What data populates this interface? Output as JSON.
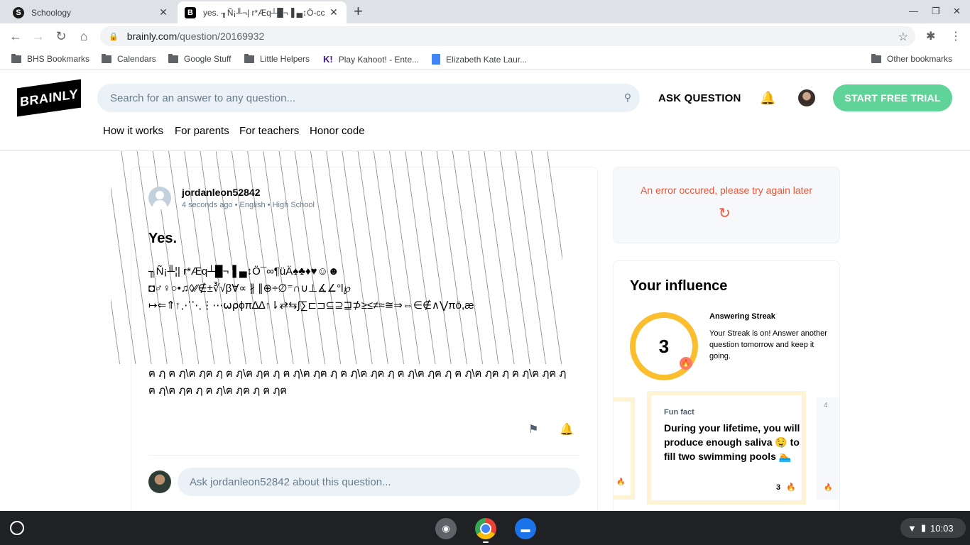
{
  "browser": {
    "tabs": [
      {
        "favicon": "S",
        "title": "Schoology"
      },
      {
        "favicon": "B",
        "title": "yes. ╖Ñ¡╨¬| r*Æq┴█¬▐ ▄↕Ö-cc"
      }
    ],
    "url_host": "brainly.com",
    "url_path": "/question/20169932",
    "bookmarks": [
      {
        "label": "BHS Bookmarks",
        "icon": "folder-icon"
      },
      {
        "label": "Calendars",
        "icon": "folder-icon"
      },
      {
        "label": "Google Stuff",
        "icon": "folder-icon"
      },
      {
        "label": "Little Helpers",
        "icon": "folder-icon"
      },
      {
        "label": "Play Kahoot! - Ente...",
        "icon": "kahoot-icon"
      },
      {
        "label": "Elizabeth Kate Laur...",
        "icon": "doc-icon"
      }
    ],
    "other_bookmarks": "Other bookmarks"
  },
  "brainly": {
    "logo": "BRAINLY",
    "search_placeholder": "Search for an answer to any question...",
    "ask_question": "ASK QUESTION",
    "trial_button": "START FREE TRIAL",
    "subnav": [
      "How it works",
      "For parents",
      "For teachers",
      "Honor code"
    ]
  },
  "question": {
    "author": "jordanleon52842",
    "time": "4 seconds ago",
    "subject": "English",
    "level": "High School",
    "title": "Yes.",
    "body_lines": [
      "╖Ñ¡╨¦| r*Æq┴█¬▐ ▄↕Ö¯∞¶üÄ♠♣♦♥☺☻",
      "◘♂♀○•♫◊⁄∕∉±∛√β∀∝ ∦ ∥⊕÷∅⁼∩∪⊥∡∠°l℘",
      "↦⇐⇑↑⋰⋱⋮⋯⍵⍴ϕπ∆∆↑⇂⇄⇆∫∑⊏⊐⊆⊇⊒⊅≥≤≠≈≅⇒⇔∈∉∧⋁πö,æ"
    ],
    "tail_text": "ฅ ฦ ฅ ฦ\\ฅ ฦฅ ฦ ฅ ฦ\\ฅ ฦฅ ฦ ฅ ฦ\\ฅ ฦฅ ฦ ฅ ฦ\\ฅ ฦฅ ฦ ฅ ฦ\\ฅ ฦฅ ฦ ฅ ฦ\\ฅ ฦฅ ฦ ฅ ฦ\\ฅ ฦฅ ฦ ฅ ฦ\\ฅ ฦฅ ฦ ฅ ฦ\\ฅ ฦฅ ฦ ฅ ฦฅ",
    "comment_placeholder": "Ask jordanleon52842 about this question..."
  },
  "sidebar": {
    "error_text": "An error occured, please try again later",
    "influence_title": "Your influence",
    "streak_count": "3",
    "streak_heading": "Answering Streak",
    "streak_text": "Your Streak is on! Answer another question tomorrow and keep it going.",
    "fact_label": "Fun fact",
    "fact_text": "During your lifetime, you will produce enough saliva 🤤 to fill two swimming pools 🏊",
    "fact_count": "3",
    "next_card_number": "4"
  },
  "shelf": {
    "time": "10:03"
  },
  "colors": {
    "brainly_green": "#60d399",
    "streak_ring": "#fbbe2e",
    "error": "#e8573a"
  }
}
